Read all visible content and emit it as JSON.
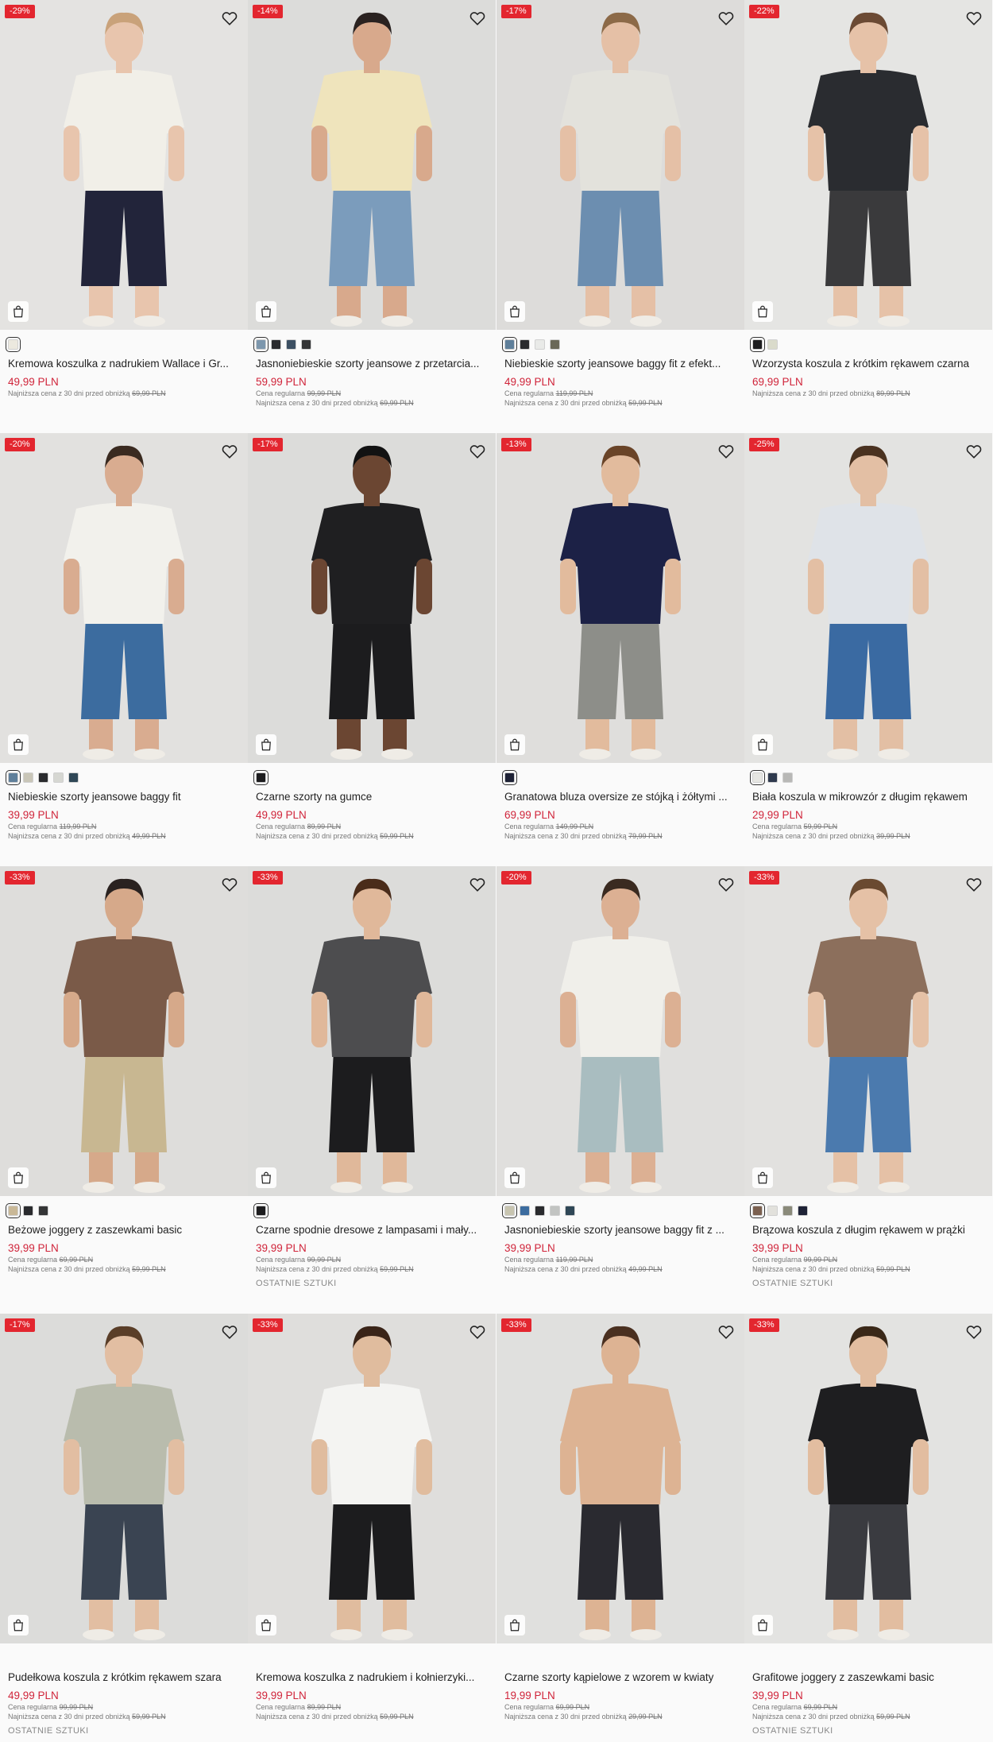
{
  "products": [
    {
      "discount": "-29%",
      "title": "Kremowa koszulka z nadrukiem Wallace i Gr...",
      "price": "49,99 PLN",
      "regular_label": "",
      "regular_price": "",
      "lowest_label": "Najniższa cena z 30 dni przed obniżką",
      "lowest_price": "69,99 PLN",
      "last_items": "",
      "swatches": [
        "#ece9df"
      ],
      "colors": {
        "bg": "#e4e3e1",
        "top": "#f1efe8",
        "bottom": "#22243a",
        "skin": "#e8c5ad",
        "hair": "#c9a27a"
      }
    },
    {
      "discount": "-14%",
      "title": "Jasnoniebieskie szorty jeansowe z przetarcia...",
      "price": "59,99 PLN",
      "regular_label": "Cena regularna",
      "regular_price": "99,99 PLN",
      "lowest_label": "Najniższa cena z 30 dni przed obniżką",
      "lowest_price": "69,99 PLN",
      "last_items": "",
      "swatches": [
        "#7d97ad",
        "#2a2b2e",
        "#3c4f62",
        "#343536"
      ],
      "colors": {
        "bg": "#dcdcda",
        "top": "#efe4bc",
        "bottom": "#7b9cbc",
        "skin": "#d8a98c",
        "hair": "#2a2220"
      }
    },
    {
      "discount": "-17%",
      "title": "Niebieskie szorty jeansowe baggy fit z efekt...",
      "price": "49,99 PLN",
      "regular_label": "Cena regularna",
      "regular_price": "119,99 PLN",
      "lowest_label": "Najniższa cena z 30 dni przed obniżką",
      "lowest_price": "59,99 PLN",
      "last_items": "",
      "swatches": [
        "#5f7f9a",
        "#2a2b2e",
        "#e9eae8",
        "#6a6858"
      ],
      "colors": {
        "bg": "#dddcda",
        "top": "#e3e2dc",
        "bottom": "#6c8eb0",
        "skin": "#e5c0a6",
        "hair": "#8c6a48"
      }
    },
    {
      "discount": "-22%",
      "title": "Wzorzysta koszula z krótkim rękawem czarna",
      "price": "69,99 PLN",
      "regular_label": "",
      "regular_price": "",
      "lowest_label": "Najniższa cena z 30 dni przed obniżką",
      "lowest_price": "89,99 PLN",
      "last_items": "",
      "swatches": [
        "#1e1e20",
        "#dadbcb"
      ],
      "colors": {
        "bg": "#e5e5e3",
        "top": "#2a2c30",
        "bottom": "#3a3a3c",
        "skin": "#e6c2a8",
        "hair": "#6b4a34"
      }
    },
    {
      "discount": "-20%",
      "title": "Niebieskie szorty jeansowe baggy fit",
      "price": "39,99 PLN",
      "regular_label": "Cena regularna",
      "regular_price": "119,99 PLN",
      "lowest_label": "Najniższa cena z 30 dni przed obniżką",
      "lowest_price": "49,99 PLN",
      "last_items": "",
      "swatches": [
        "#5f7f9a",
        "#c9c6b8",
        "#2a2b2e",
        "#d6d7d2",
        "#2f4756"
      ],
      "colors": {
        "bg": "#e2e1df",
        "top": "#f2f1ec",
        "bottom": "#3c6c9f",
        "skin": "#d9ac90",
        "hair": "#3a2a20"
      }
    },
    {
      "discount": "-17%",
      "title": "Czarne szorty na gumce",
      "price": "49,99 PLN",
      "regular_label": "Cena regularna",
      "regular_price": "89,99 PLN",
      "lowest_label": "Najniższa cena z 30 dni przed obniżką",
      "lowest_price": "59,99 PLN",
      "last_items": "",
      "swatches": [
        "#1d1d1f"
      ],
      "colors": {
        "bg": "#dcdcda",
        "top": "#1f1f21",
        "bottom": "#1c1c1e",
        "skin": "#6b4632",
        "hair": "#121212"
      }
    },
    {
      "discount": "-13%",
      "title": "Granatowa bluza oversize ze stójką i żółtymi ...",
      "price": "69,99 PLN",
      "regular_label": "Cena regularna",
      "regular_price": "149,99 PLN",
      "lowest_label": "Najniższa cena z 30 dni przed obniżką",
      "lowest_price": "79,99 PLN",
      "last_items": "",
      "swatches": [
        "#1e2236"
      ],
      "colors": {
        "bg": "#dfdedc",
        "top": "#1c2146",
        "bottom": "#8d8e89",
        "skin": "#e2bb9d",
        "hair": "#6a4428"
      }
    },
    {
      "discount": "-25%",
      "title": "Biała koszula w mikrowzór z długim rękawem",
      "price": "29,99 PLN",
      "regular_label": "Cena regularna",
      "regular_price": "59,99 PLN",
      "lowest_label": "Najniższa cena z 30 dni przed obniżką",
      "lowest_price": "39,99 PLN",
      "last_items": "",
      "swatches": [
        "#e6e6e2",
        "#2f3a4e",
        "#b8b8b6"
      ],
      "colors": {
        "bg": "#e3e3e1",
        "top": "#dfe3e8",
        "bottom": "#3a6aa2",
        "skin": "#e3bfa4",
        "hair": "#4a3220"
      }
    },
    {
      "discount": "-33%",
      "title": "Beżowe joggery z zaszewkami basic",
      "price": "39,99 PLN",
      "regular_label": "Cena regularna",
      "regular_price": "69,99 PLN",
      "lowest_label": "Najniższa cena z 30 dni przed obniżką",
      "lowest_price": "59,99 PLN",
      "last_items": "",
      "swatches": [
        "#c9b897",
        "#2a2b2e",
        "#343536"
      ],
      "colors": {
        "bg": "#dedddb",
        "top": "#7a5a48",
        "bottom": "#c8b791",
        "skin": "#d6a98a",
        "hair": "#2a2220"
      }
    },
    {
      "discount": "-33%",
      "title": "Czarne spodnie dresowe z lampasami i mały...",
      "price": "39,99 PLN",
      "regular_label": "Cena regularna",
      "regular_price": "99,99 PLN",
      "lowest_label": "Najniższa cena z 30 dni przed obniżką",
      "lowest_price": "59,99 PLN",
      "last_items": "OSTATNIE SZTUKI",
      "swatches": [
        "#1d1d1f"
      ],
      "colors": {
        "bg": "#dcdcda",
        "top": "#4d4d4f",
        "bottom": "#1c1c1e",
        "skin": "#e0b89a",
        "hair": "#4a2c1a"
      }
    },
    {
      "discount": "-20%",
      "title": "Jasnoniebieskie szorty jeansowe baggy fit z ...",
      "price": "39,99 PLN",
      "regular_label": "Cena regularna",
      "regular_price": "119,99 PLN",
      "lowest_label": "Najniższa cena z 30 dni przed obniżką",
      "lowest_price": "49,99 PLN",
      "last_items": "",
      "swatches": [
        "#c8c5b0",
        "#3c6c9f",
        "#2a2b2e",
        "#c2c4c2",
        "#2f4756"
      ],
      "colors": {
        "bg": "#e0dfdd",
        "top": "#f0efea",
        "bottom": "#a9bdc0",
        "skin": "#dcb093",
        "hair": "#3a2a20"
      }
    },
    {
      "discount": "-33%",
      "title": "Brązowa koszula z długim rękawem w prążki",
      "price": "39,99 PLN",
      "regular_label": "Cena regularna",
      "regular_price": "99,99 PLN",
      "lowest_label": "Najniższa cena z 30 dni przed obniżką",
      "lowest_price": "59,99 PLN",
      "last_items": "OSTATNIE SZTUKI",
      "swatches": [
        "#7b6050",
        "#e2e1dc",
        "#8a8a7a",
        "#1e2236"
      ],
      "colors": {
        "bg": "#e2e1df",
        "top": "#8c6f5c",
        "bottom": "#4b7aae",
        "skin": "#e5c1a6",
        "hair": "#6a4a30"
      }
    },
    {
      "discount": "-17%",
      "title": "Pudełkowa koszula z krótkim rękawem szara",
      "price": "49,99 PLN",
      "regular_label": "Cena regularna",
      "regular_price": "99,99 PLN",
      "lowest_label": "Najniższa cena z 30 dni przed obniżką",
      "lowest_price": "59,99 PLN",
      "last_items": "OSTATNIE SZTUKI",
      "swatches": [],
      "colors": {
        "bg": "#dcdcda",
        "top": "#b9bcad",
        "bottom": "#3a4452",
        "skin": "#e2bea2",
        "hair": "#5a3e28"
      }
    },
    {
      "discount": "-33%",
      "title": "Kremowa koszulka z nadrukiem i kołnierzyki...",
      "price": "39,99 PLN",
      "regular_label": "Cena regularna",
      "regular_price": "89,99 PLN",
      "lowest_label": "Najniższa cena z 30 dni przed obniżką",
      "lowest_price": "59,99 PLN",
      "last_items": "",
      "swatches": [],
      "colors": {
        "bg": "#dfdedc",
        "top": "#f4f4f2",
        "bottom": "#1c1c1e",
        "skin": "#e0bc9e",
        "hair": "#3a2418"
      }
    },
    {
      "discount": "-33%",
      "title": "Czarne szorty kąpielowe z wzorem w kwiaty",
      "price": "19,99 PLN",
      "regular_label": "Cena regularna",
      "regular_price": "69,99 PLN",
      "lowest_label": "Najniższa cena z 30 dni przed obniżką",
      "lowest_price": "29,99 PLN",
      "last_items": "",
      "swatches": [],
      "colors": {
        "bg": "#e0e0de",
        "top": "#ddb393",
        "bottom": "#2a2a30",
        "skin": "#ddb393",
        "hair": "#4a3020"
      }
    },
    {
      "discount": "-33%",
      "title": "Grafitowe joggery z zaszewkami basic",
      "price": "39,99 PLN",
      "regular_label": "Cena regularna",
      "regular_price": "69,99 PLN",
      "lowest_label": "Najniższa cena z 30 dni przed obniżką",
      "lowest_price": "59,99 PLN",
      "last_items": "OSTATNIE SZTUKI",
      "swatches": [],
      "colors": {
        "bg": "#e3e3e1",
        "top": "#1e1e20",
        "bottom": "#3a3b40",
        "skin": "#e2bda0",
        "hair": "#3a2818"
      }
    }
  ],
  "icons": {
    "wishlist": "heart-icon",
    "bag": "shopping-bag-icon"
  }
}
